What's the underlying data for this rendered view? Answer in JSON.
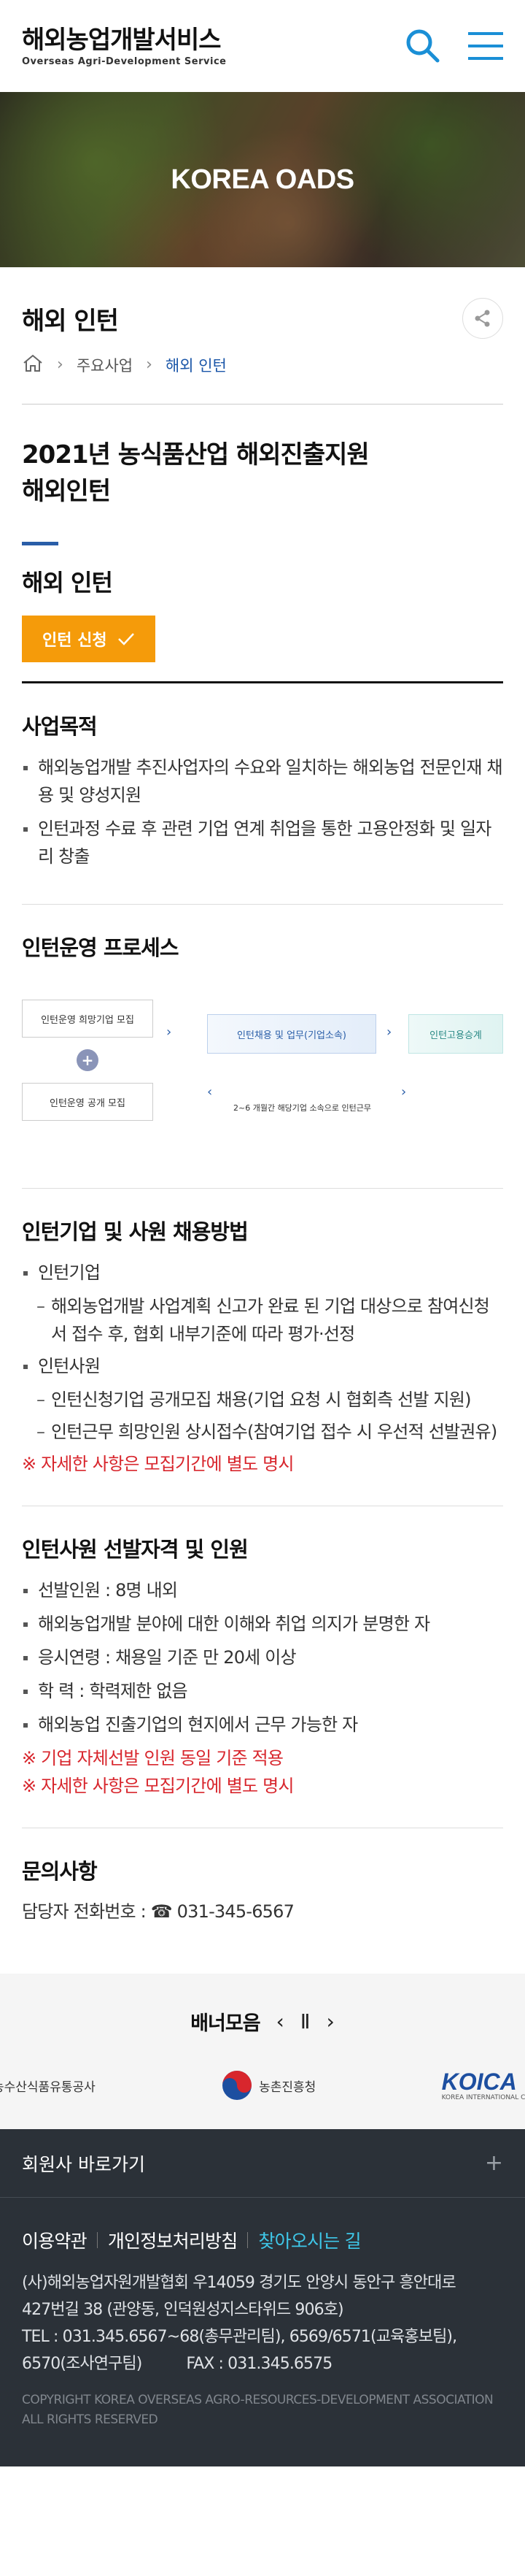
{
  "header": {
    "logo_title": "해외농업개발서비스",
    "logo_sub": "Overseas Agri-Development Service",
    "search_icon": "search-icon",
    "menu_icon": "menu-icon",
    "accent": "#1a8fd6"
  },
  "hero": {
    "title": "KOREA OADS"
  },
  "page": {
    "title": "해외 인턴",
    "breadcrumb": [
      "주요사업",
      "해외 인턴"
    ],
    "heading_line1": "2021년 농식품산업 해외진출지원",
    "heading_line2": "해외인턴",
    "sub_title": "해외 인턴",
    "apply_label": "인턴 신청"
  },
  "purpose": {
    "title": "사업목적",
    "items": [
      "해외농업개발 추진사업자의 수요와 일치하는 해외농업 전문인재 채용 및 양성지원",
      "인턴과정 수료 후 관련 기업 연계 취업을 통한 고용안정화 및 일자리 창출"
    ]
  },
  "process": {
    "title": "인턴운영 프로세스",
    "box1": "인턴운영 희망기업 모집",
    "box2": "인턴운영 공개 모집",
    "box3": "인턴채용 및 업무(기업소속)",
    "box4": "인턴고용승계",
    "note": "2~6 개월간 해당기업 소속으로 인턴근무"
  },
  "recruit": {
    "title": "인턴기업 및 사원 채용방법",
    "company_label": "인턴기업",
    "company_items": [
      "해외농업개발 사업계획 신고가 완료 된 기업 대상으로 참여신청서 접수 후, 협회 내부기준에 따라 평가·선정"
    ],
    "intern_label": "인턴사원",
    "intern_items": [
      "인턴신청기업 공개모집 채용(기업 요청 시 협회측 선발 지원)",
      "인턴근무 희망인원 상시접수(참여기업 접수 시 우선적 선발권유)"
    ],
    "note": "※ 자세한 사항은 모집기간에 별도 명시"
  },
  "qualification": {
    "title": "인턴사원 선발자격 및 인원",
    "items": [
      "선발인원 : 8명 내외",
      "해외농업개발 분야에 대한 이해와 취업 의지가 분명한 자",
      "응시연령 : 채용일 기준 만 20세 이상",
      "학 력 : 학력제한 없음",
      "해외농업 진출기업의 현지에서 근무 가능한 자"
    ],
    "note1": "※ 기업 자체선발 인원 동일 기준 적용",
    "note2": "※ 자세한 사항은 모집기간에 별도 명시"
  },
  "contact": {
    "title": "문의사항",
    "text": "담당자 전화번호 : ☎ 031-345-6567"
  },
  "banner": {
    "title": "배너모음",
    "logos": [
      "농수산식품유통공사",
      "농촌진흥청",
      "KOICA"
    ],
    "koica_sub": "KOREA INTERNATIONAL COOP"
  },
  "footer": {
    "family": "회원사 바로가기",
    "links": [
      "이용약관",
      "개인정보처리방침",
      "찾아오시는 길"
    ],
    "address1": "(사)해외농업자원개발협회 우14059 경기도 안양시 동안구 흥안대로",
    "address2": "427번길 38 (관양동, 인덕원성지스타위드 906호)",
    "tel1": "TEL : 031.345.6567~68(총무관리팀), 6569/6571(교육홍보팀),",
    "tel2": "6570(조사연구팀)          FAX : 031.345.6575",
    "copyright": "COPYRIGHT KOREA OVERSEAS AGRO-RESOURCES-DEVELOPMENT ASSOCIATION ALL RIGHTS RESERVED"
  }
}
